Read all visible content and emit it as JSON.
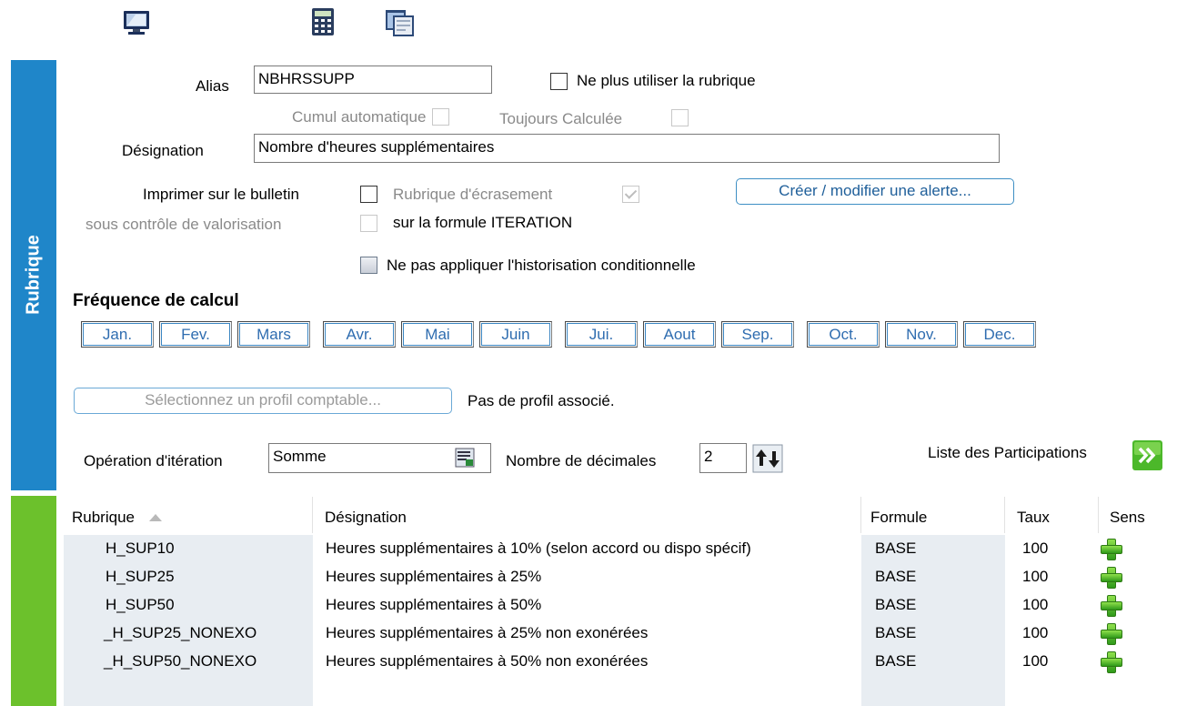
{
  "toolbar": {
    "icons": [
      "monitor-icon",
      "calculator-icon",
      "window-icon"
    ]
  },
  "sidebar": {
    "tab_rubrique": "Rubrique"
  },
  "form": {
    "alias_label": "Alias",
    "alias_value": "NBHRSSUPP",
    "ne_plus_utiliser_label": "Ne plus utiliser la rubrique",
    "cumul_auto_label": "Cumul automatique",
    "toujours_calculee_label": "Toujours Calculée",
    "designation_label": "Désignation",
    "designation_value": "Nombre d'heures supplémentaires",
    "imprimer_label": "Imprimer sur le bulletin",
    "sous_controle_label": "sous contrôle de valorisation",
    "rubrique_ecrasement_label": "Rubrique d'écrasement",
    "sur_formule_label": "sur la formule ITERATION",
    "creer_alerte_label": "Créer / modifier une alerte...",
    "historisation_label": "Ne pas appliquer l'historisation conditionnelle",
    "frequence_title": "Fréquence de calcul",
    "months": [
      "Jan.",
      "Fev.",
      "Mars",
      "Avr.",
      "Mai",
      "Juin",
      "Jui.",
      "Aout",
      "Sep.",
      "Oct.",
      "Nov.",
      "Dec."
    ],
    "profil_button_label": "Sélectionnez un profil comptable...",
    "profil_status": "Pas de profil associé.",
    "operation_label": "Opération d'itération",
    "operation_value": "Somme",
    "decimales_label": "Nombre de décimales",
    "decimales_value": "2",
    "participations_label": "Liste des Participations"
  },
  "grid": {
    "headers": {
      "rubrique": "Rubrique",
      "designation": "Désignation",
      "formule": "Formule",
      "taux": "Taux",
      "sens": "Sens"
    },
    "rows": [
      {
        "rubrique": "H_SUP10",
        "designation": "Heures supplémentaires à 10% (selon accord ou dispo spécif)",
        "formule": "BASE",
        "taux": "100",
        "sens": "plus-icon"
      },
      {
        "rubrique": "H_SUP25",
        "designation": "Heures supplémentaires à 25%",
        "formule": "BASE",
        "taux": "100",
        "sens": "plus-icon"
      },
      {
        "rubrique": "H_SUP50",
        "designation": "Heures supplémentaires à 50%",
        "formule": "BASE",
        "taux": "100",
        "sens": "plus-icon"
      },
      {
        "rubrique": "_H_SUP25_NONEXO",
        "designation": "Heures supplémentaires à 25% non exonérées",
        "formule": "BASE",
        "taux": "100",
        "sens": "plus-icon"
      },
      {
        "rubrique": "_H_SUP50_NONEXO",
        "designation": "Heures supplémentaires à 50% non exonérées",
        "formule": "BASE",
        "taux": "100",
        "sens": "plus-icon"
      }
    ]
  },
  "colors": {
    "sidebar_blue": "#1f86c9",
    "sidebar_green": "#6cc12c",
    "link_blue": "#2f6db0"
  }
}
